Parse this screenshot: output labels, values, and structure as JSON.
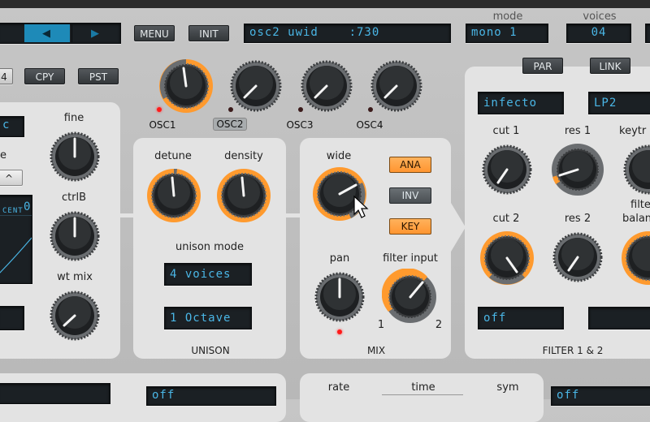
{
  "header": {
    "menu_label": "MENU",
    "init_label": "INIT",
    "preset_display": "osc2 uwid    :730",
    "mode_caption": "mode",
    "mode_value": "mono 1",
    "voices_caption": "voices",
    "voices_value": "04"
  },
  "left": {
    "partial_field": "4",
    "copy_label": "CPY",
    "paste_label": "PST",
    "fine_label": "fine",
    "ctrlb_label": "ctrlB",
    "wtmix_label": "wt mix",
    "cent_label": "CENT",
    "cent_value": "0",
    "dropdown_partial": "c",
    "partial_e": "e"
  },
  "osc_select": {
    "labels": [
      "OSC1",
      "OSC2",
      "OSC3",
      "OSC4"
    ],
    "selected": "OSC2"
  },
  "unison": {
    "detune_label": "detune",
    "density_label": "density",
    "mode_label": "unison mode",
    "mode_value": "4 voices",
    "octave_value": "1 Octave",
    "panel_title": "UNISON"
  },
  "mix": {
    "wide_label": "wide",
    "ana_label": "ANA",
    "inv_label": "INV",
    "key_label": "KEY",
    "pan_label": "pan",
    "filter_input_label": "filter input",
    "range_min": "1",
    "range_max": "2",
    "panel_title": "MIX"
  },
  "filter": {
    "par_label": "PAR",
    "link_label": "LINK",
    "filter1_type": "infecto",
    "filter2_type": "LP2",
    "cut1_label": "cut 1",
    "res1_label": "res 1",
    "keytrack_label": "keytr",
    "cut2_label": "cut 2",
    "res2_label": "res 2",
    "balance_label_1": "filte",
    "balance_label_2": "balan",
    "routing_value": "off",
    "panel_title": "FILTER 1 & 2"
  },
  "bottom": {
    "left_dropdown": "off",
    "rate_label": "rate",
    "time_label": "time",
    "sym_label": "sym",
    "right_dropdown": "off"
  },
  "colors": {
    "accent_orange": "#ff9a2e",
    "lcd_text": "#4ab6e6",
    "panel": "#e3e3e3",
    "led_red": "#ff1b1b"
  }
}
